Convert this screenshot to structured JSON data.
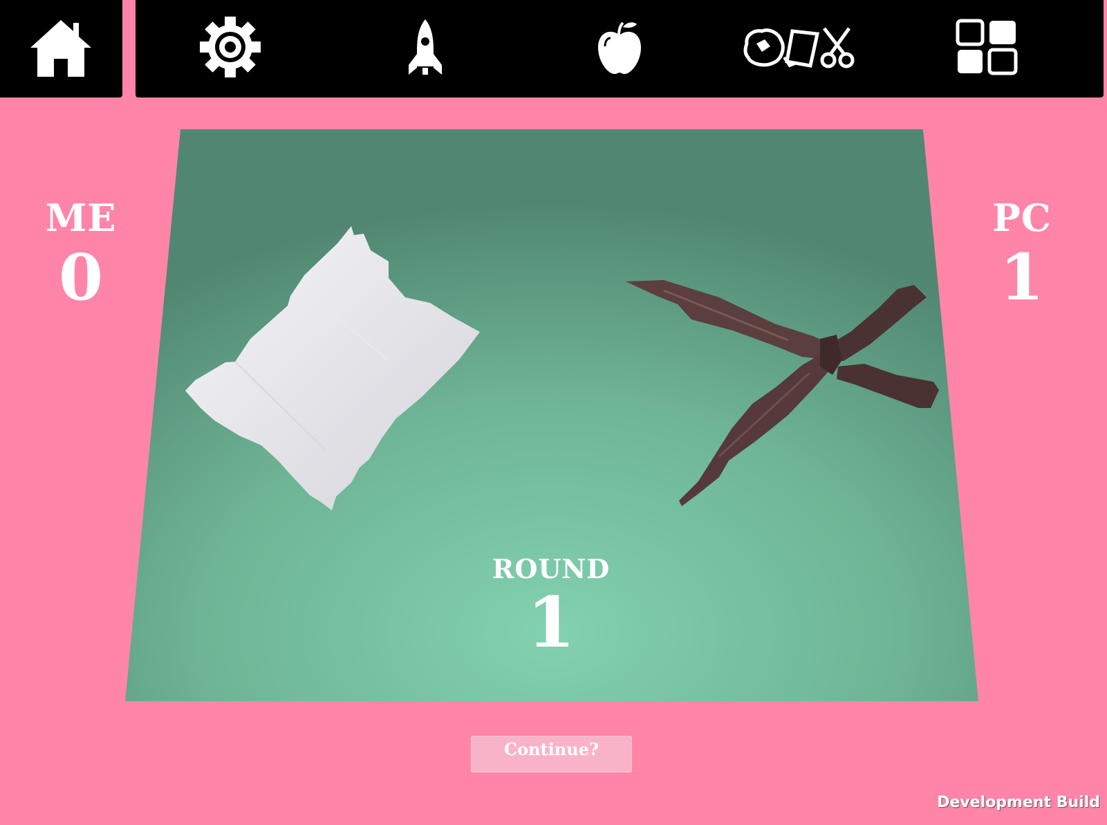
{
  "nav": {
    "items": [
      {
        "icon": "home-icon"
      },
      {
        "icon": "gear-icon"
      },
      {
        "icon": "rocket-icon"
      },
      {
        "icon": "apple-icon"
      },
      {
        "icon": "rock-paper-scissors-icon"
      },
      {
        "icon": "grid-icon"
      }
    ]
  },
  "scores": {
    "me_label": "ME",
    "me_value": "0",
    "pc_label": "PC",
    "pc_value": "1"
  },
  "round": {
    "label": "ROUND",
    "value": "1"
  },
  "continue_label": "Continue?",
  "footer": {
    "dev_build": "Development Build"
  },
  "colors": {
    "background": "#ff85a8",
    "table_green": "#6fb79a",
    "topbar": "#000000",
    "continue_button": "#f9b3c9"
  },
  "player_choice": "paper",
  "pc_choice": "scissors"
}
